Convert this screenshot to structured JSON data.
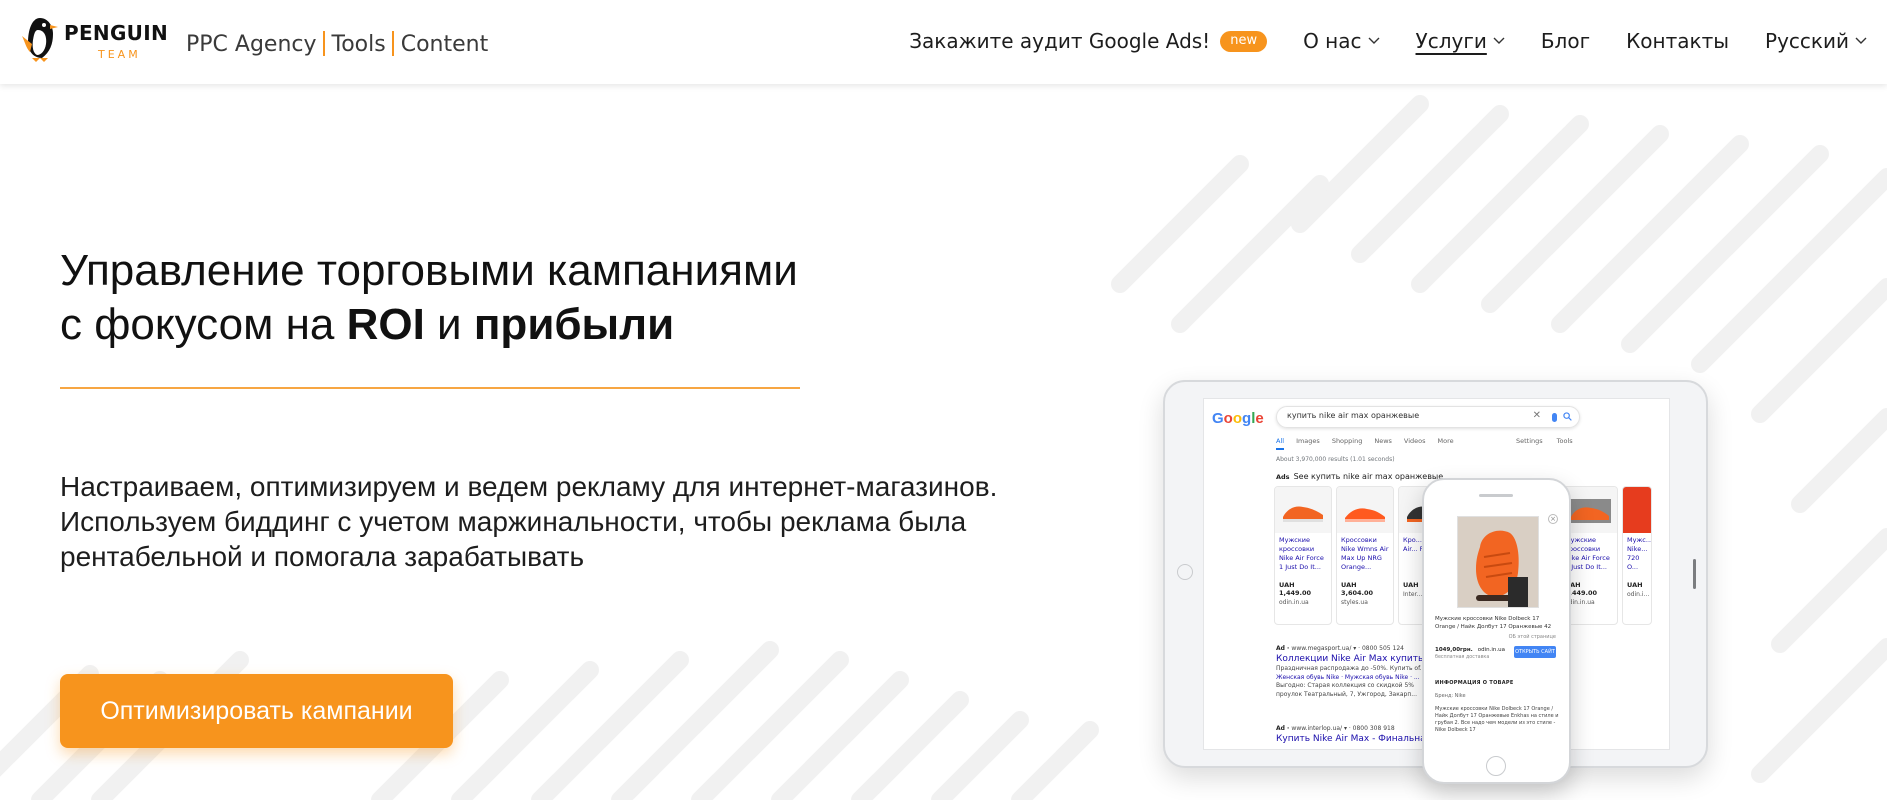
{
  "brand": {
    "name_top": "PENGUIN",
    "name_bottom": "TEAM",
    "accent_color": "#f7941d"
  },
  "header": {
    "top_links": [
      "PPC Agency",
      "Tools",
      "Content"
    ],
    "nav": {
      "audit_label": "Закажите аудит Google Ads!",
      "audit_badge": "new",
      "about_label": "О нас",
      "services_label": "Услуги",
      "blog_label": "Блог",
      "contacts_label": "Контакты",
      "language_label": "Русский"
    }
  },
  "hero": {
    "title_line1": "Управление торговыми кампаниями",
    "title_line2_prefix": "с фокусом на ",
    "title_bold1": "ROI",
    "title_mid": " и ",
    "title_bold2": "прибыли",
    "desc_line1": "Настраиваем, оптимизируем и ведем рекламу для интернет-магазинов.",
    "desc_line2": "Используем биддинг с учетом маржинальности, чтобы реклама была",
    "desc_line3": "рентабельной и помогала зарабатывать",
    "cta_label": "Оптимизировать кампании"
  },
  "mockup": {
    "google_logo": "Google",
    "search_query": "купить nike air max оранжевые",
    "tabs": [
      "All",
      "Images",
      "Shopping",
      "News",
      "Videos",
      "More"
    ],
    "tabs_right": [
      "Settings",
      "Tools"
    ],
    "results_count": "About 3,970,000 results (1.01 seconds)",
    "ads_label": "Ads",
    "ads_heading": "See купить nike air max оранжевые",
    "products": [
      {
        "title": "Мужские кроссовки Nike Air Force 1 Just Do It...",
        "price": "UAH 1,449.00",
        "shop": "odin.in.ua"
      },
      {
        "title": "Кроссовки Nike Wmns Air Max Up NRG Orange...",
        "price": "UAH 3,604.00",
        "shop": "styles.ua"
      },
      {
        "title": "Кро... fashi... Air... Prem...",
        "price": "UAH",
        "shop": "Inter..."
      },
      {
        "title": "",
        "price": "",
        "shop": ""
      },
      {
        "title": "",
        "price": "",
        "shop": ""
      },
      {
        "title": "Мужские кроссовки Nike Air Force 1 Just Do It...",
        "price": "UAH 1,449.00",
        "shop": "odin.in.ua"
      },
      {
        "title": "Мужс... Nike... 720 O...",
        "price": "UAH",
        "shop": "odin.i..."
      }
    ],
    "text_ads": [
      {
        "url": "www.megasport.ua/",
        "phone": "0800 505 124",
        "title": "Коллекции Nike Air Max купить в ...",
        "lines": [
          "Праздничная распродажа до -50%. Купить оf...",
          "Женская обувь Nike · Мужская обувь Nike · ...",
          "Выгодно: Старая коллекция со скидкой 5%",
          "проулок Театральный, 7, Ужгород, Закарп..."
        ]
      },
      {
        "url": "www.interlop.ua/",
        "phone": "0800 308 918",
        "title": "Купить Nike Air Max - Финальная ...",
        "lines": []
      }
    ],
    "phone": {
      "product_title": "Мужские кроссовки Nike Dolbeck 17 Orange / Найк Долбут 17 Оранжевые 42",
      "sub": "ОБ этой странице",
      "price": "1049,00грн.",
      "shop": "odin.in.ua",
      "price_note": "бесплатная доставка",
      "buy_label": "ОТКРЫТЬ САЙТ",
      "info_heading": "ИНФОРМАЦИЯ О ТОВАРЕ",
      "brand_line": "Бренд: Nike",
      "info_text": "Мужские кроссовки Nike Dolbeck 17 Orange / Найк Долбут 17 Оранжевые Enkhas на стиле и грубая 2. Все надо чем модели из это стиле - Nike Dolbeck 17"
    }
  }
}
